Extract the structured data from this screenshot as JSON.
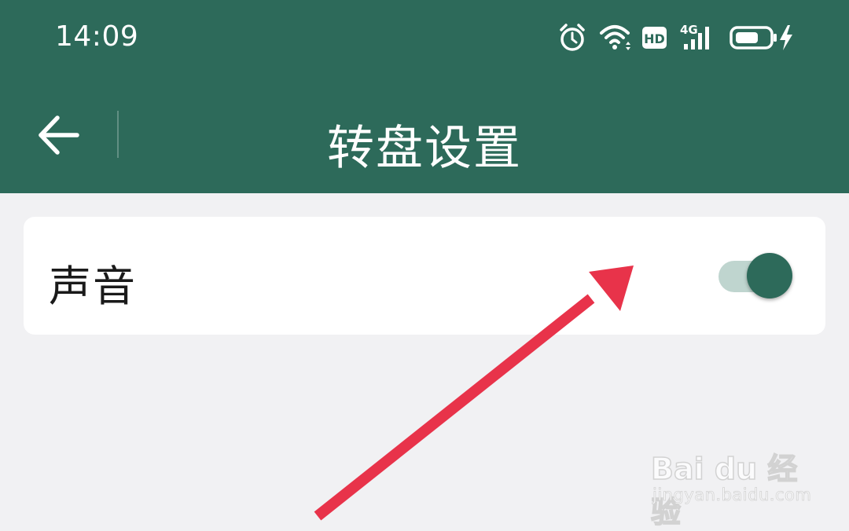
{
  "status_bar": {
    "time": "14:09",
    "icons": [
      "alarm-icon",
      "wifi-icon",
      "hd-icon",
      "signal-4g-icon",
      "battery-charging-icon"
    ],
    "network_label": "4G",
    "hd_label": "HD"
  },
  "app_bar": {
    "back_icon": "arrow-left-icon",
    "title": "转盘设置"
  },
  "settings": {
    "sound": {
      "label": "声音",
      "enabled": true
    }
  },
  "annotation": {
    "arrow_color": "#e8334a"
  },
  "colors": {
    "primary": "#2d6a5a",
    "background": "#f1f1f3",
    "toggle_track": "#bfd5cf"
  },
  "watermark": {
    "logo": "Bai du 经验",
    "url": "jingyan.baidu.com"
  }
}
